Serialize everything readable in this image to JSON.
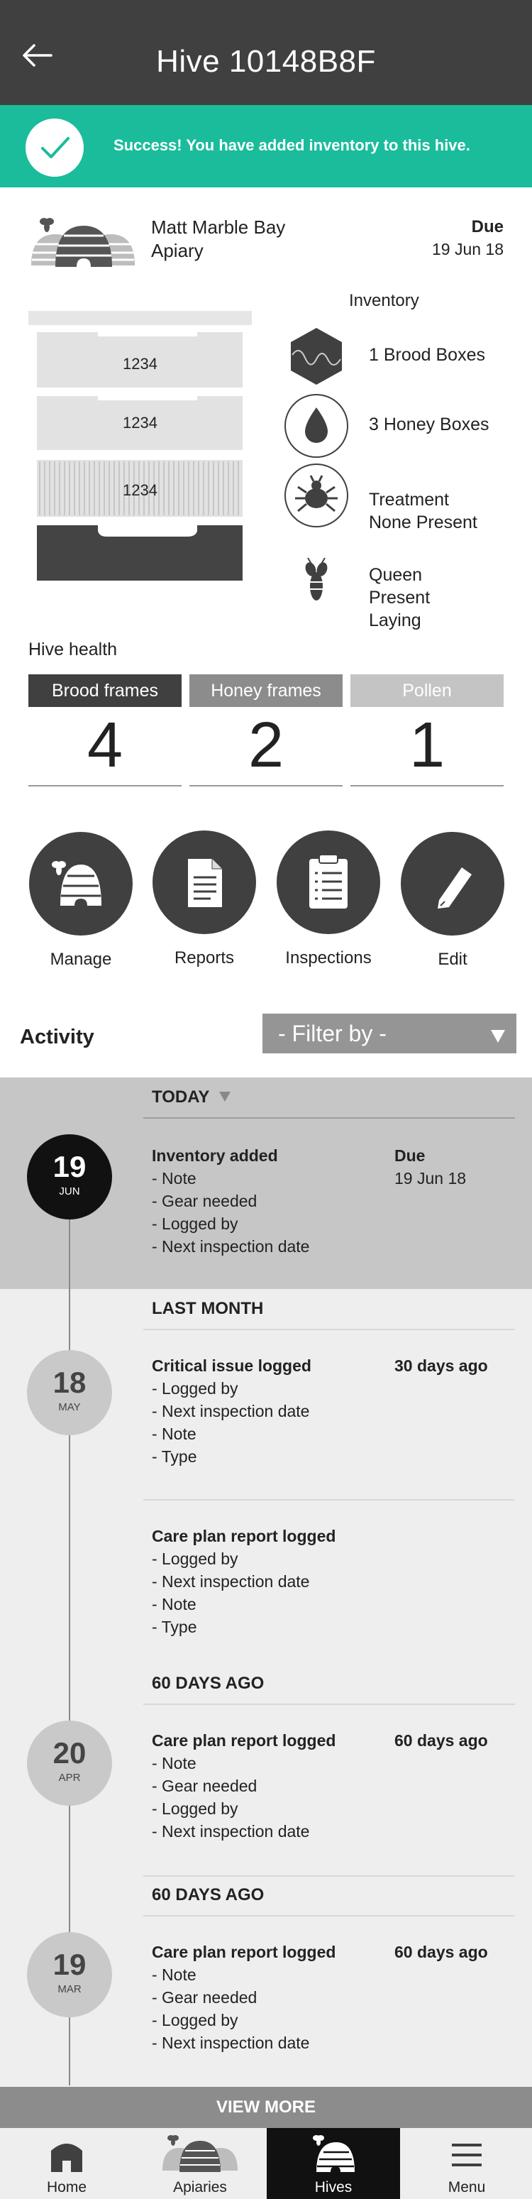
{
  "header": {
    "title": "Hive 10148B8F",
    "back_icon": "back-arrow-icon"
  },
  "banner": {
    "message": "Success! You have added inventory to this hive.",
    "icon": "check-icon",
    "color": "#1abc9c"
  },
  "apiary": {
    "name": "Matt Marble Bay Apiary",
    "due_label": "Due",
    "due_date": "19 Jun 18"
  },
  "hive_boxes": [
    "1234",
    "1234",
    "1234"
  ],
  "inventory": {
    "title": "Inventory",
    "brood": "1 Brood Boxes",
    "honey": "3 Honey Boxes",
    "treatment_l1": "Treatment",
    "treatment_l2": "None Present",
    "queen_l1": "Queen",
    "queen_l2": "Present",
    "queen_l3": "Laying"
  },
  "health": {
    "title": "Hive health",
    "brood_label": "Brood frames",
    "brood_value": "4",
    "brood_color": "#404040",
    "honey_label": "Honey frames",
    "honey_value": "2",
    "honey_color": "#8c8c8c",
    "pollen_label": "Pollen",
    "pollen_value": "1",
    "pollen_color": "#c4c4c4"
  },
  "actions": {
    "manage": "Manage",
    "reports": "Reports",
    "inspections": "Inspections",
    "edit": "Edit"
  },
  "activity": {
    "title": "Activity",
    "filter_label": "- Filter by  -"
  },
  "timeline": {
    "today": {
      "header": "TODAY",
      "day": "19",
      "month": "JUN",
      "title": "Inventory added",
      "right_label": "Due",
      "right_value": "19 Jun 18",
      "lines": [
        "- Note",
        "- Gear needed",
        "- Logged by",
        "- Next inspection date"
      ]
    },
    "last_month": {
      "header": "LAST MONTH",
      "day": "18",
      "month": "MAY",
      "e1_title": "Critical issue logged",
      "e1_right": "30 days ago",
      "e1_lines": [
        "- Logged by",
        "- Next inspection date",
        "- Note",
        "- Type"
      ],
      "e2_title": "Care plan report logged",
      "e2_lines": [
        "- Logged by",
        "- Next inspection date",
        "- Note",
        "- Type"
      ]
    },
    "g60a": {
      "header": "60 DAYS AGO",
      "day": "20",
      "month": "APR",
      "title": "Care plan report logged",
      "right": "60 days ago",
      "lines": [
        "- Note",
        "- Gear needed",
        "- Logged by",
        "- Next inspection date"
      ]
    },
    "g60b": {
      "header": "60 DAYS AGO",
      "day": "19",
      "month": "MAR",
      "title": "Care plan report logged",
      "right": "60 days ago",
      "lines": [
        "- Note",
        "- Gear needed",
        "- Logged by",
        "- Next inspection date"
      ]
    }
  },
  "view_more": "VIEW MORE",
  "tabs": {
    "home": "Home",
    "apiaries": "Apiaries",
    "hives": "Hives",
    "menu": "Menu",
    "active": "hives"
  }
}
